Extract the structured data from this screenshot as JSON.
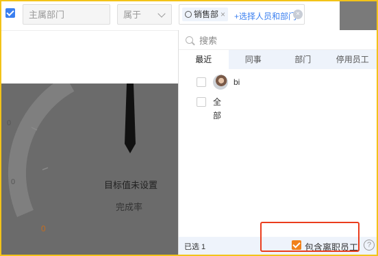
{
  "filter": {
    "dept_placeholder": "主属部门",
    "relation_label": "属于",
    "tag_label": "销售部",
    "tag_remove": "×",
    "add_link": "+选择人员和部门",
    "clear_glyph": "×"
  },
  "gauge": {
    "tick_labels": [
      "0",
      "0",
      "0"
    ],
    "goal_text": "目标值未设置",
    "rate_text": "完成率"
  },
  "panel": {
    "search_placeholder": "搜索",
    "tabs": [
      {
        "label": "最近",
        "active": true
      },
      {
        "label": "同事",
        "active": false
      },
      {
        "label": "部门",
        "active": false
      },
      {
        "label": "停用员工",
        "active": false
      }
    ],
    "items": [
      {
        "label": "bi"
      },
      {
        "label": "全部"
      }
    ],
    "footer": {
      "selected_label": "已选 1",
      "include_label": "包含离职员工",
      "help_glyph": "?"
    }
  },
  "colors": {
    "accent": "#3a7ff0",
    "orange_check": "#f1811b",
    "highlight_red": "#ea3c1c",
    "frame_yellow": "#f3c318"
  }
}
